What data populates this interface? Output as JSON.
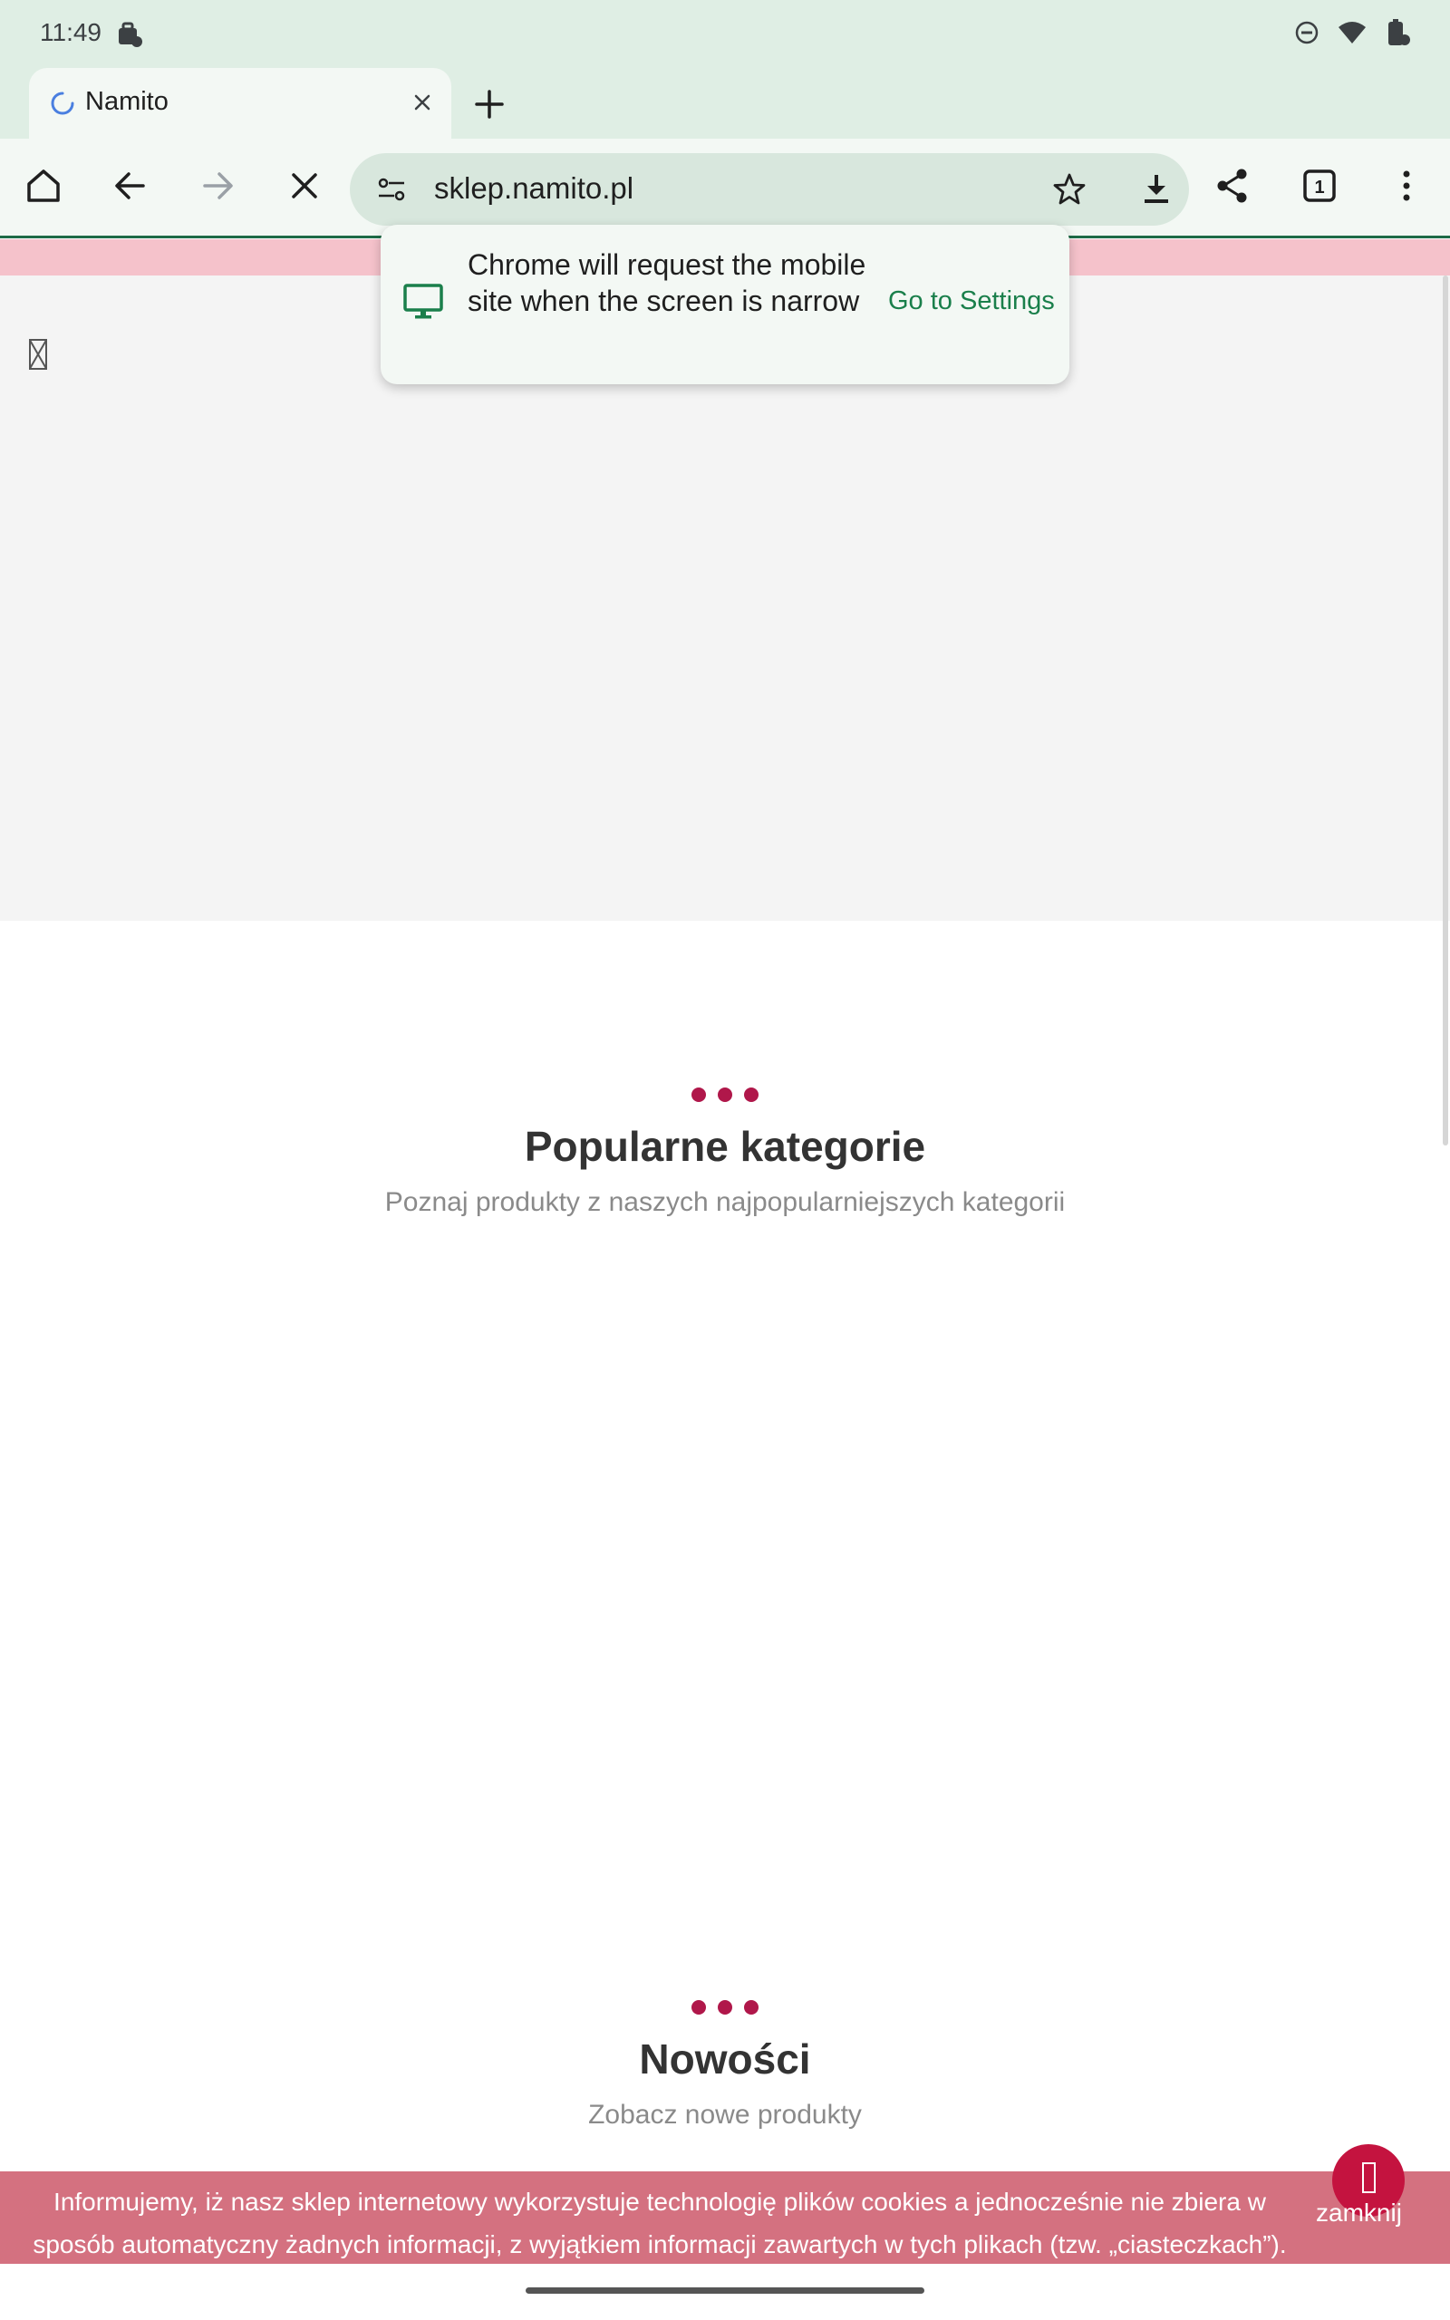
{
  "status_bar": {
    "time": "11:49",
    "icons": [
      "briefcase-icon",
      "dnd-icon",
      "wifi-icon",
      "battery-icon"
    ]
  },
  "tab": {
    "title": "Namito",
    "close_icon": "close-icon",
    "new_tab_icon": "plus-icon"
  },
  "toolbar": {
    "buttons": [
      "home-icon",
      "back-icon",
      "forward-icon",
      "stop-icon",
      "share-icon",
      "tab-switcher-icon",
      "menu-icon"
    ],
    "url": "sklep.namito.pl",
    "tab_count": "1"
  },
  "popup": {
    "message": "Chrome will request the mobile site when the screen is narrow",
    "action": "Go to Settings"
  },
  "sections": [
    {
      "title": "Popularne kategorie",
      "subtitle": "Poznaj produkty z naszych najpopularniejszych kategorii"
    },
    {
      "title": "Nowości",
      "subtitle": "Zobacz nowe produkty"
    }
  ],
  "cookie_banner": {
    "text": "Informujemy, iż nasz sklep internetowy wykorzystuje technologię plików cookies a jednocześnie nie zbiera w sposób automatyczny żadnych informacji, z wyjątkiem informacji zawartych w tych plikach (tzw. „ciasteczkach”).",
    "close_label": "zamknij"
  },
  "colors": {
    "browser_chrome": "#dfeee4",
    "accent_green": "#1a7f4b",
    "brand_crimson": "#b0174a",
    "cookie_banner": "#d47180",
    "pink_strip": "#f5c2cb"
  }
}
